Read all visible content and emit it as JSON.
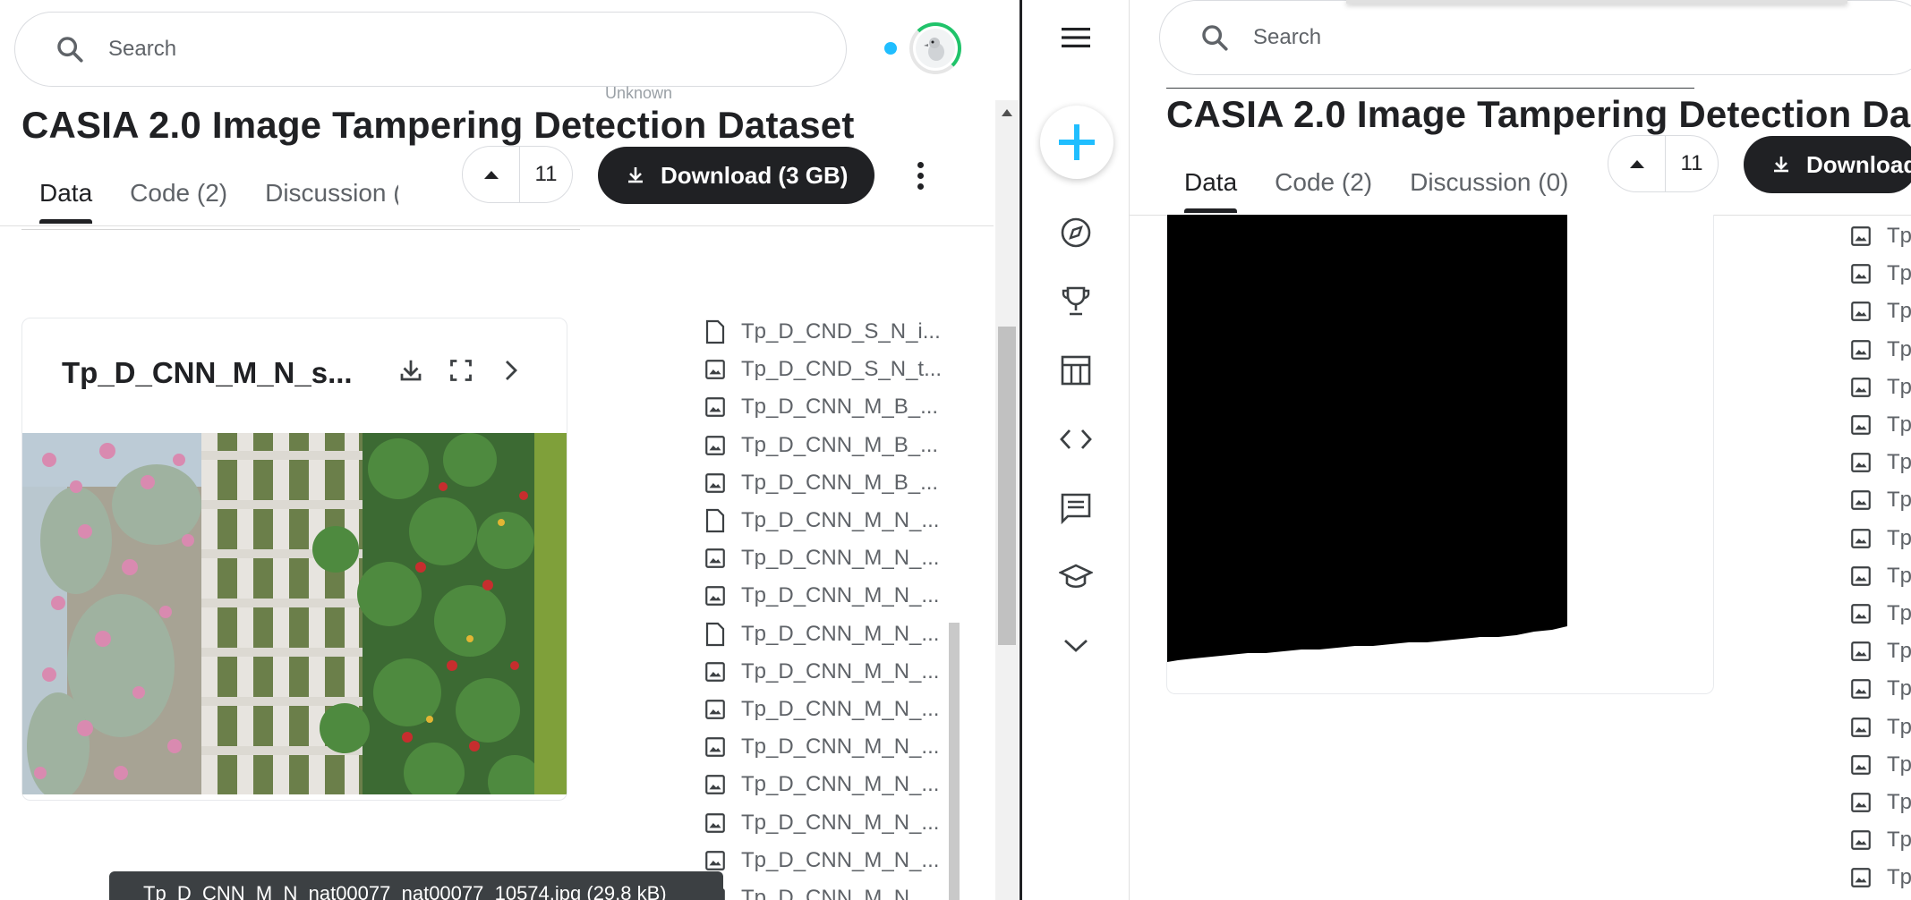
{
  "search": {
    "placeholder": "Search"
  },
  "dataset": {
    "title": "CASIA 2.0 Image Tampering Detection Dataset"
  },
  "tabs": [
    {
      "label": "Data"
    },
    {
      "label": "Code (2)"
    },
    {
      "label": "Discussion (0)"
    }
  ],
  "vote": {
    "count": "11"
  },
  "download": {
    "label": "Download (3 GB)",
    "label_clipped": "Download"
  },
  "ghost_text": "Unknown",
  "preview": {
    "title": "Tp_D_CNN_M_N_s..."
  },
  "files": [
    {
      "name": "Tp_D_CND_S_N_i...",
      "icon": "file-icon"
    },
    {
      "name": "Tp_D_CND_S_N_t...",
      "icon": "image-icon"
    },
    {
      "name": "Tp_D_CNN_M_B_...",
      "icon": "image-icon"
    },
    {
      "name": "Tp_D_CNN_M_B_...",
      "icon": "image-icon"
    },
    {
      "name": "Tp_D_CNN_M_B_...",
      "icon": "image-icon"
    },
    {
      "name": "Tp_D_CNN_M_N_...",
      "icon": "file-icon"
    },
    {
      "name": "Tp_D_CNN_M_N_...",
      "icon": "image-icon"
    },
    {
      "name": "Tp_D_CNN_M_N_...",
      "icon": "image-icon"
    },
    {
      "name": "Tp_D_CNN_M_N_...",
      "icon": "file-icon"
    },
    {
      "name": "Tp_D_CNN_M_N_...",
      "icon": "image-icon"
    },
    {
      "name": "Tp_D_CNN_M_N_...",
      "icon": "image-icon"
    },
    {
      "name": "Tp_D_CNN_M_N_...",
      "icon": "image-icon"
    },
    {
      "name": "Tp_D_CNN_M_N_...",
      "icon": "image-icon"
    },
    {
      "name": "Tp_D_CNN_M_N_...",
      "icon": "image-icon"
    },
    {
      "name": "Tp_D_CNN_M_N_...",
      "icon": "image-icon"
    },
    {
      "name": "Tp_D_CNN_M_N_...",
      "icon": "image-icon"
    }
  ],
  "tooltip": {
    "text": "Tp_D_CNN_M_N_nat00077_nat00077_10574.jpg (29.8 kB)"
  },
  "right_files": [
    {
      "name": "Tp"
    },
    {
      "name": "Tp"
    },
    {
      "name": "Tp"
    },
    {
      "name": "Tp"
    },
    {
      "name": "Tp"
    },
    {
      "name": "Tp"
    },
    {
      "name": "Tp"
    },
    {
      "name": "Tp"
    },
    {
      "name": "Tp"
    },
    {
      "name": "Tp"
    },
    {
      "name": "Tp"
    },
    {
      "name": "Tp"
    },
    {
      "name": "Tp"
    },
    {
      "name": "Tp"
    },
    {
      "name": "Tp"
    },
    {
      "name": "Tp"
    },
    {
      "name": "Tp"
    },
    {
      "name": "Tp"
    }
  ],
  "nav": {
    "items": [
      "menu-icon",
      "create-icon",
      "explore-icon",
      "competitions-icon",
      "datasets-icon",
      "code-icon",
      "discussions-icon",
      "learn-icon",
      "more-icon"
    ]
  },
  "colors": {
    "accent": "#20beff",
    "dark": "#202124",
    "muted": "#5f6368",
    "progress": "#20c36a"
  }
}
